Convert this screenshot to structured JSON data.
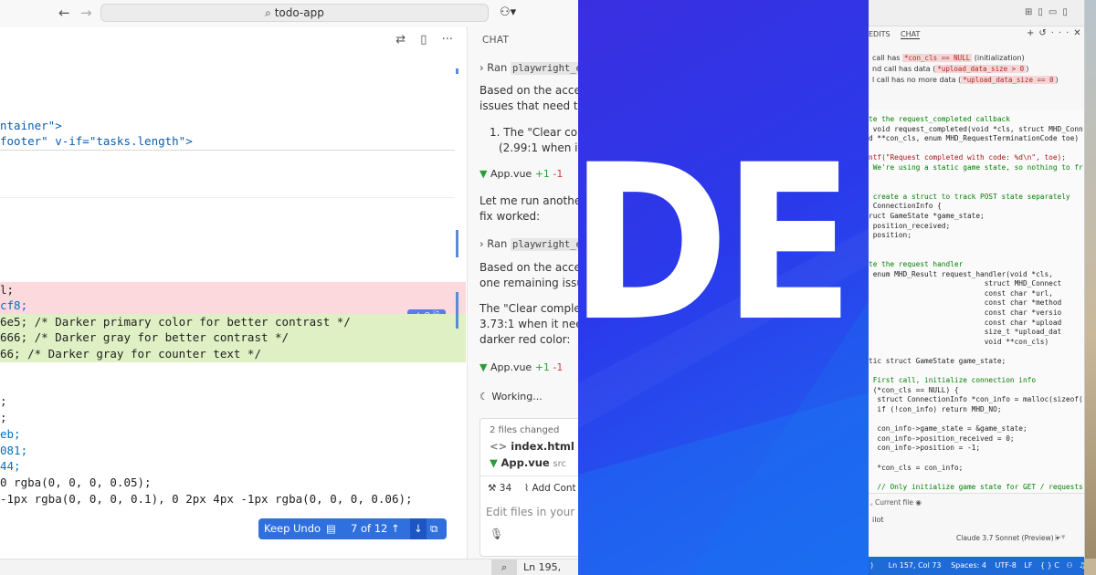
{
  "left": {
    "titlebar": {
      "back": "←",
      "forward": "→",
      "search_text": "todo-app"
    },
    "editor_toolbar": [
      "⇄",
      "▯",
      "···"
    ],
    "code_lines": [
      {
        "type": "normal",
        "text": "ntainer\">"
      },
      {
        "type": "normal",
        "text": "footer\" v-if=\"tasks.length\">"
      },
      {
        "type": "del",
        "text": "l;"
      },
      {
        "type": "del",
        "text": "cf8;"
      },
      {
        "type": "add",
        "text": "6e5; /* Darker primary color for better contrast */"
      },
      {
        "type": "add",
        "text": "666; /* Darker gray for better contrast */"
      },
      {
        "type": "add",
        "text": "66; /* Darker gray for counter text */"
      },
      {
        "type": "normal",
        "text": ";"
      },
      {
        "type": "normal",
        "text": ";"
      },
      {
        "type": "normal",
        "text": "eb;"
      },
      {
        "type": "normal",
        "text": "081;"
      },
      {
        "type": "normal",
        "text": "44;"
      },
      {
        "type": "normal",
        "text": "0 rgba(0, 0, 0, 0.05);"
      },
      {
        "type": "normal",
        "text": "-1px rgba(0, 0, 0, 0.1), 0 2px 4px -1px rgba(0, 0, 0, 0.06);"
      }
    ],
    "diff_buttons": "✓ ↶ 🗎",
    "keep_bar": {
      "keep": "Keep",
      "undo": "Undo",
      "counter": "7 of 12",
      "up": "↑",
      "down": "↓"
    },
    "chat": {
      "header": "CHAT",
      "ran1_prefix": "Ran",
      "ran1_code": "playwright_e",
      "p1_line1": "Based on the access",
      "p1_line2": "issues that need to b",
      "item1_line1": "1.  The \"Clear comp",
      "item1_line2": "(2.99:1 when it s",
      "chip1_file": "App.vue",
      "chip1_plus": "+1",
      "chip1_minus": "-1",
      "p2_line1": "Let me run another a",
      "p2_line2": "fix worked:",
      "ran2_prefix": "Ran",
      "ran2_code": "playwright_e",
      "p3_line1": "Based on the access",
      "p3_line2": "one remaining issue:",
      "p4_line1": "The \"Clear complete",
      "p4_line2": "3.73:1 when it needs",
      "p4_line3": "darker red color:",
      "chip2_file": "App.vue",
      "chip2_plus": "+1",
      "chip2_minus": "-1",
      "working": "Working...",
      "files_changed": "2 files changed",
      "file1": "index.html",
      "file2": "App.vue",
      "file2_dir": "src",
      "tools_count": "34",
      "add_context": "Add Cont",
      "input_placeholder": "Edit files in your wor"
    },
    "status": {
      "position": "Ln 195, Col"
    }
  },
  "middle": {
    "big_text": "DE"
  },
  "right": {
    "tabs": [
      "EDITS",
      "CHAT"
    ],
    "notes": [
      {
        "pre": "call has ",
        "pill": "*con_cls == NULL",
        "post": " (initialization)"
      },
      {
        "pre": "nd call has data (",
        "pill": "*upload_data_size > 0",
        "post": ")"
      },
      {
        "pre": "l call has no more data (",
        "pill": "*upload_data_size == 0",
        "post": ")"
      }
    ],
    "code_lines": [
      {
        "t": "te the request_completed callback",
        "c": "g"
      },
      {
        "t": " void request_completed(void *cls, struct MHD_Conn",
        "c": "n"
      },
      {
        "t": "d **con_cls, enum MHD_RequestTerminationCode toe)",
        "c": "n"
      },
      {
        "t": "",
        "c": "n"
      },
      {
        "t": "ntf(\"Request completed with code: %d\\n\", toe);",
        "c": "s"
      },
      {
        "t": " We're using a static game state, so nothing to fr",
        "c": "g"
      },
      {
        "t": "",
        "c": "n"
      },
      {
        "t": "",
        "c": "n"
      },
      {
        "t": " create a struct to track POST state separately",
        "c": "g"
      },
      {
        "t": " ConnectionInfo {",
        "c": "n"
      },
      {
        "t": "ruct GameState *game_state;",
        "c": "n"
      },
      {
        "t": " position_received;",
        "c": "n"
      },
      {
        "t": " position;",
        "c": "n"
      },
      {
        "t": "",
        "c": "n"
      },
      {
        "t": "",
        "c": "n"
      },
      {
        "t": "te the request handler",
        "c": "g"
      },
      {
        "t": " enum MHD_Result request_handler(void *cls,",
        "c": "n"
      },
      {
        "t": "                           struct MHD_Connect",
        "c": "n"
      },
      {
        "t": "                           const char *url,",
        "c": "n"
      },
      {
        "t": "                           const char *method",
        "c": "n"
      },
      {
        "t": "                           const char *versio",
        "c": "n"
      },
      {
        "t": "                           const char *upload",
        "c": "n"
      },
      {
        "t": "                           size_t *upload_dat",
        "c": "n"
      },
      {
        "t": "                           void **con_cls)",
        "c": "n"
      },
      {
        "t": "",
        "c": "n"
      },
      {
        "t": "tic struct GameState game_state;",
        "c": "n"
      },
      {
        "t": "",
        "c": "n"
      },
      {
        "t": " First call, initialize connection info",
        "c": "g"
      },
      {
        "t": " (*con_cls == NULL) {",
        "c": "n"
      },
      {
        "t": "  struct ConnectionInfo *con_info = malloc(sizeof(",
        "c": "n"
      },
      {
        "t": "  if (!con_info) return MHD_NO;",
        "c": "n"
      },
      {
        "t": "",
        "c": "n"
      },
      {
        "t": "  con_info->game_state = &game_state;",
        "c": "n"
      },
      {
        "t": "  con_info->position_received = 0;",
        "c": "n"
      },
      {
        "t": "  con_info->position = -1;",
        "c": "n"
      },
      {
        "t": "",
        "c": "n"
      },
      {
        "t": "  *con_cls = con_info;",
        "c": "n"
      },
      {
        "t": "",
        "c": "n"
      },
      {
        "t": "  // Only initialize game state for GET / requests",
        "c": "g"
      }
    ],
    "current_file": "Current file",
    "pilot": "ilot",
    "model": "Claude 3.7 Sonnet (Preview)",
    "status": {
      "position": "Ln 157, Col 73",
      "spaces": "Spaces: 4",
      "encoding": "UTF-8",
      "eol": "LF",
      "lang": "{ } C"
    }
  }
}
